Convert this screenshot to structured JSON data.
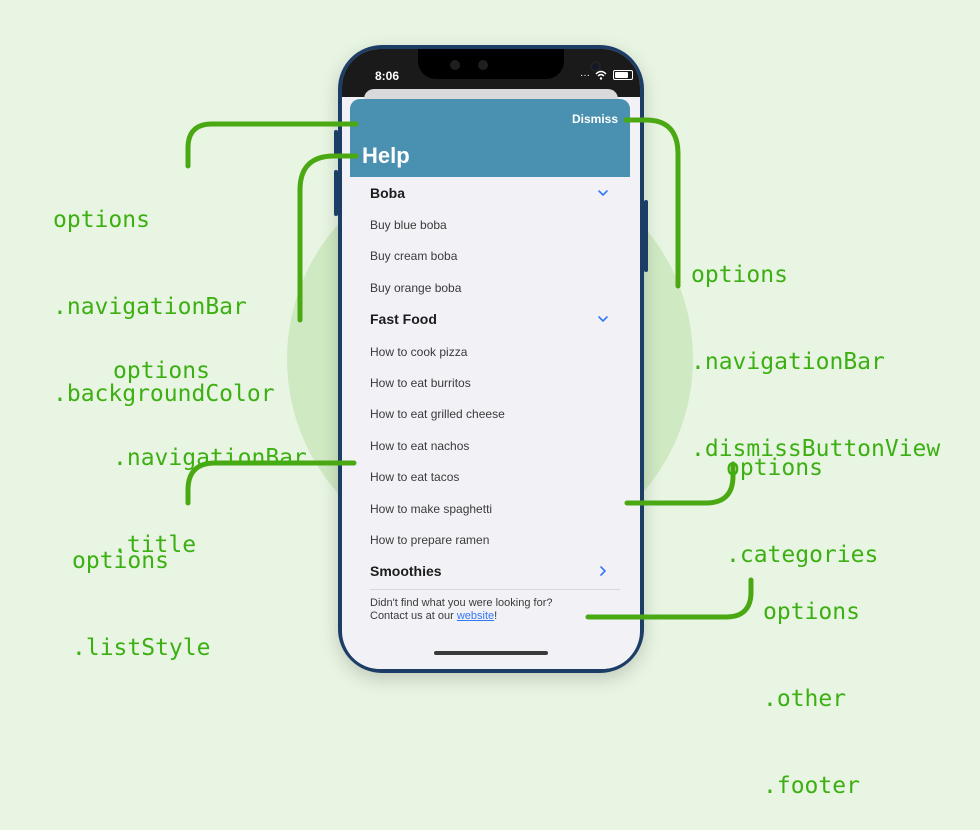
{
  "phone": {
    "time": "8:06",
    "navbar_title": "Help",
    "dismiss_label": "Dismiss",
    "navbar_color": "#4a90b0",
    "categories": [
      {
        "title": "Boba",
        "expanded": true,
        "items": [
          "Buy blue boba",
          "Buy cream boba",
          "Buy orange boba"
        ]
      },
      {
        "title": "Fast Food",
        "expanded": true,
        "items": [
          "How to cook pizza",
          "How to eat burritos",
          "How to eat grilled cheese",
          "How to eat nachos",
          "How to eat tacos",
          "How to make spaghetti",
          "How to prepare ramen"
        ]
      },
      {
        "title": "Smoothies",
        "expanded": false,
        "items": []
      }
    ],
    "footer": {
      "line1": "Didn't find what you were looking for?",
      "line2_prefix": "Contact us at our ",
      "link_text": "website",
      "line2_suffix": "!"
    }
  },
  "annotations": {
    "background_color": [
      "options",
      ".navigationBar",
      ".backgroundColor"
    ],
    "title": [
      "options",
      ".navigationBar",
      ".title"
    ],
    "list_style": [
      "options",
      ".listStyle"
    ],
    "dismiss_button": [
      "options",
      ".navigationBar",
      ".dismissButtonView"
    ],
    "categories": [
      "options",
      ".categories"
    ],
    "footer": [
      "options",
      ".other",
      ".footer"
    ]
  },
  "colors": {
    "background": "#e9f5e3",
    "circle": "#cfe9c3",
    "annotation": "#3cb012",
    "leader": "#4aa812",
    "link": "#3478f6",
    "chevron": "#3478f6"
  }
}
